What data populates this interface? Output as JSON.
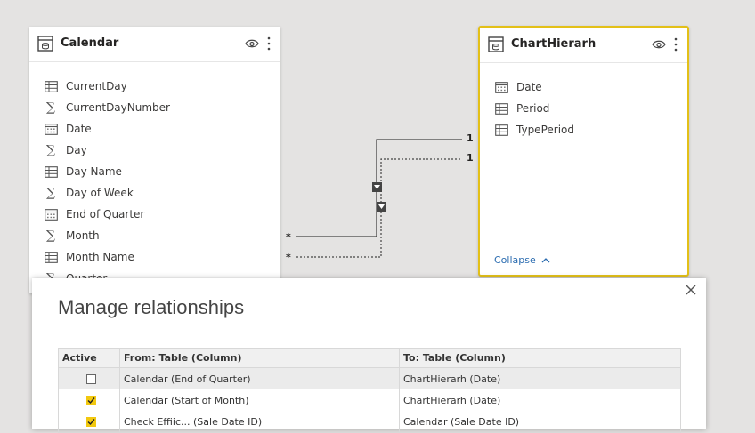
{
  "calendar_table": {
    "title": "Calendar",
    "fields": [
      {
        "name": "CurrentDay",
        "icon": "table-icon"
      },
      {
        "name": "CurrentDayNumber",
        "icon": "sigma-icon"
      },
      {
        "name": "Date",
        "icon": "calendar-icon"
      },
      {
        "name": "Day",
        "icon": "sigma-icon"
      },
      {
        "name": "Day Name",
        "icon": "table-icon"
      },
      {
        "name": "Day of Week",
        "icon": "sigma-icon"
      },
      {
        "name": "End of Quarter",
        "icon": "calendar-icon"
      },
      {
        "name": "Month",
        "icon": "sigma-icon"
      },
      {
        "name": "Month Name",
        "icon": "table-icon"
      },
      {
        "name": "Quarter",
        "icon": "sigma-icon"
      }
    ]
  },
  "chart_table": {
    "title": "ChartHierarh",
    "fields": [
      {
        "name": "Date",
        "icon": "calendar-icon"
      },
      {
        "name": "Period",
        "icon": "table-icon"
      },
      {
        "name": "TypePeriod",
        "icon": "table-icon"
      }
    ],
    "collapse_label": "Collapse"
  },
  "relationships": {
    "one_label": "1",
    "many_label": "*"
  },
  "dialog": {
    "title": "Manage relationships",
    "columns": [
      "Active",
      "From: Table (Column)",
      "To: Table (Column)"
    ],
    "rows": [
      {
        "active": false,
        "from": "Calendar (End of Quarter)",
        "to": "ChartHierarh (Date)"
      },
      {
        "active": true,
        "from": "Calendar (Start of Month)",
        "to": "ChartHierarh (Date)"
      },
      {
        "active": true,
        "from": "Check Effiic... (Sale Date ID)",
        "to": "Calendar (Sale Date ID)"
      }
    ]
  },
  "colors": {
    "accent": "#e3c018",
    "checkbox": "#f2c80f",
    "link": "#2b6cb0"
  }
}
